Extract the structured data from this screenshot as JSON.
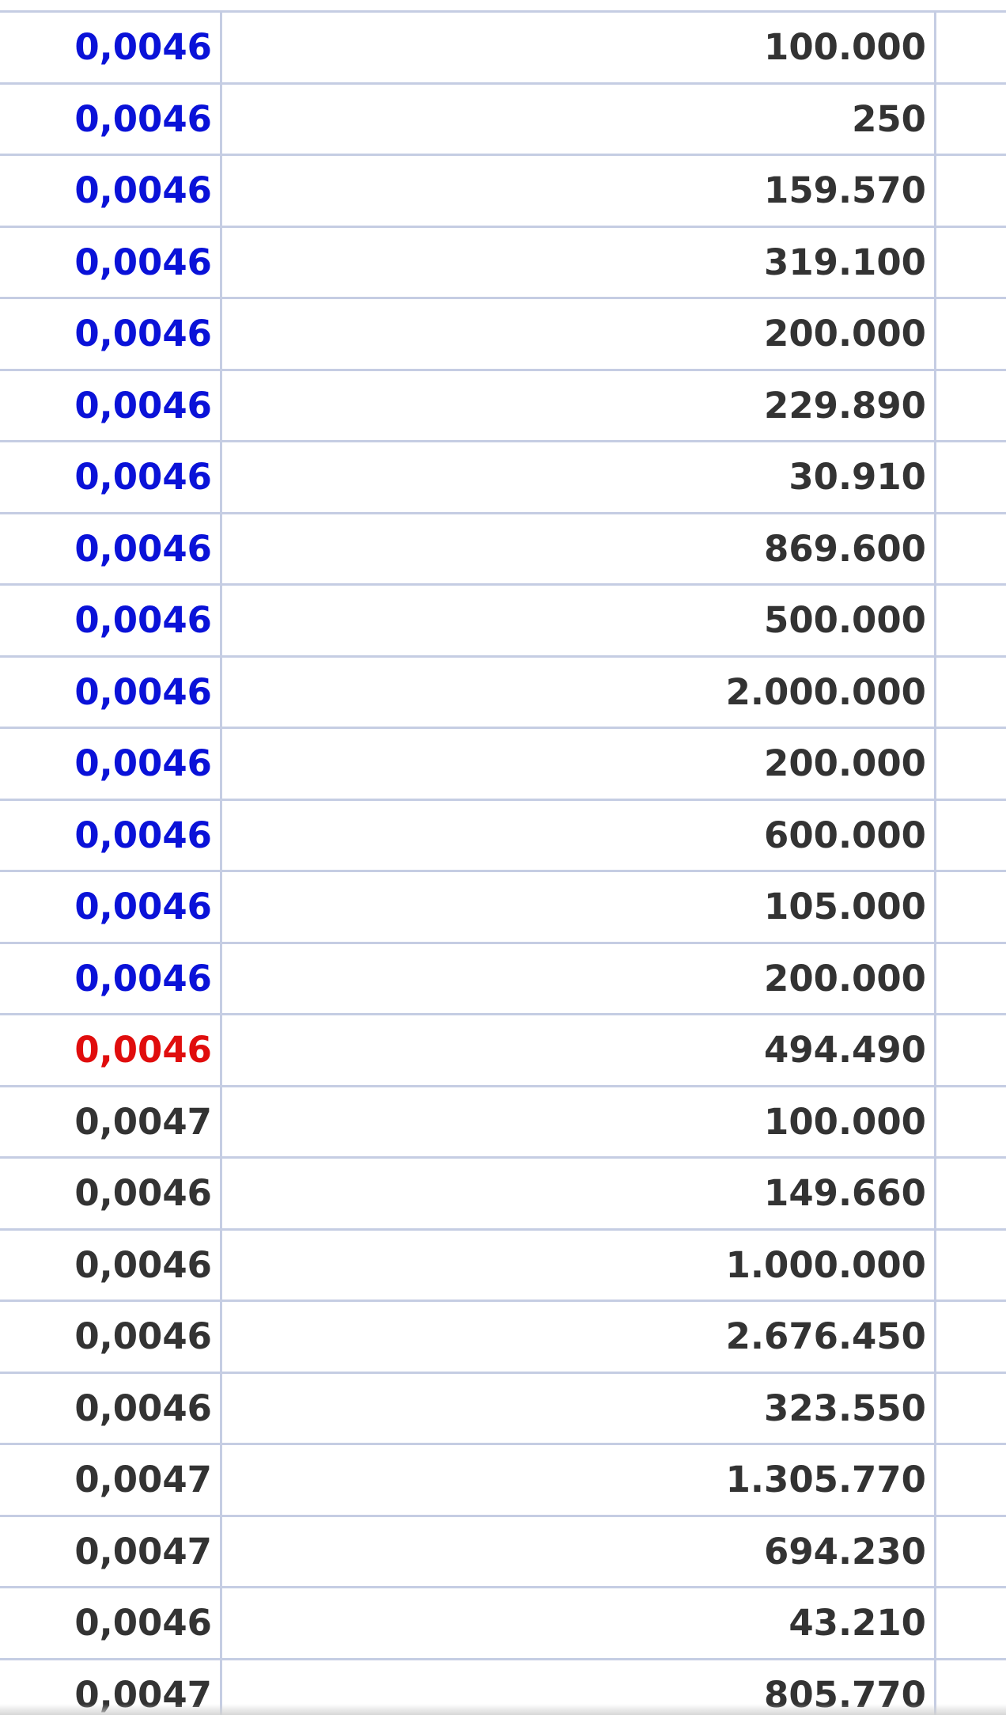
{
  "colors": {
    "grid_line": "#c5cde3",
    "text_default": "#333333",
    "price_buy": "#0a12d8",
    "price_highlight": "#e00d0d",
    "background": "#ffffff"
  },
  "trades": [
    {
      "price": "0,0046",
      "quantity": "100.000",
      "price_color": "blue"
    },
    {
      "price": "0,0046",
      "quantity": "250",
      "price_color": "blue"
    },
    {
      "price": "0,0046",
      "quantity": "159.570",
      "price_color": "blue"
    },
    {
      "price": "0,0046",
      "quantity": "319.100",
      "price_color": "blue"
    },
    {
      "price": "0,0046",
      "quantity": "200.000",
      "price_color": "blue"
    },
    {
      "price": "0,0046",
      "quantity": "229.890",
      "price_color": "blue"
    },
    {
      "price": "0,0046",
      "quantity": "30.910",
      "price_color": "blue"
    },
    {
      "price": "0,0046",
      "quantity": "869.600",
      "price_color": "blue"
    },
    {
      "price": "0,0046",
      "quantity": "500.000",
      "price_color": "blue"
    },
    {
      "price": "0,0046",
      "quantity": "2.000.000",
      "price_color": "blue"
    },
    {
      "price": "0,0046",
      "quantity": "200.000",
      "price_color": "blue"
    },
    {
      "price": "0,0046",
      "quantity": "600.000",
      "price_color": "blue"
    },
    {
      "price": "0,0046",
      "quantity": "105.000",
      "price_color": "blue"
    },
    {
      "price": "0,0046",
      "quantity": "200.000",
      "price_color": "blue"
    },
    {
      "price": "0,0046",
      "quantity": "494.490",
      "price_color": "red"
    },
    {
      "price": "0,0047",
      "quantity": "100.000",
      "price_color": "default"
    },
    {
      "price": "0,0046",
      "quantity": "149.660",
      "price_color": "default"
    },
    {
      "price": "0,0046",
      "quantity": "1.000.000",
      "price_color": "default"
    },
    {
      "price": "0,0046",
      "quantity": "2.676.450",
      "price_color": "default"
    },
    {
      "price": "0,0046",
      "quantity": "323.550",
      "price_color": "default"
    },
    {
      "price": "0,0047",
      "quantity": "1.305.770",
      "price_color": "default"
    },
    {
      "price": "0,0047",
      "quantity": "694.230",
      "price_color": "default"
    },
    {
      "price": "0,0046",
      "quantity": "43.210",
      "price_color": "default"
    },
    {
      "price": "0,0047",
      "quantity": "805.770",
      "price_color": "default"
    }
  ]
}
